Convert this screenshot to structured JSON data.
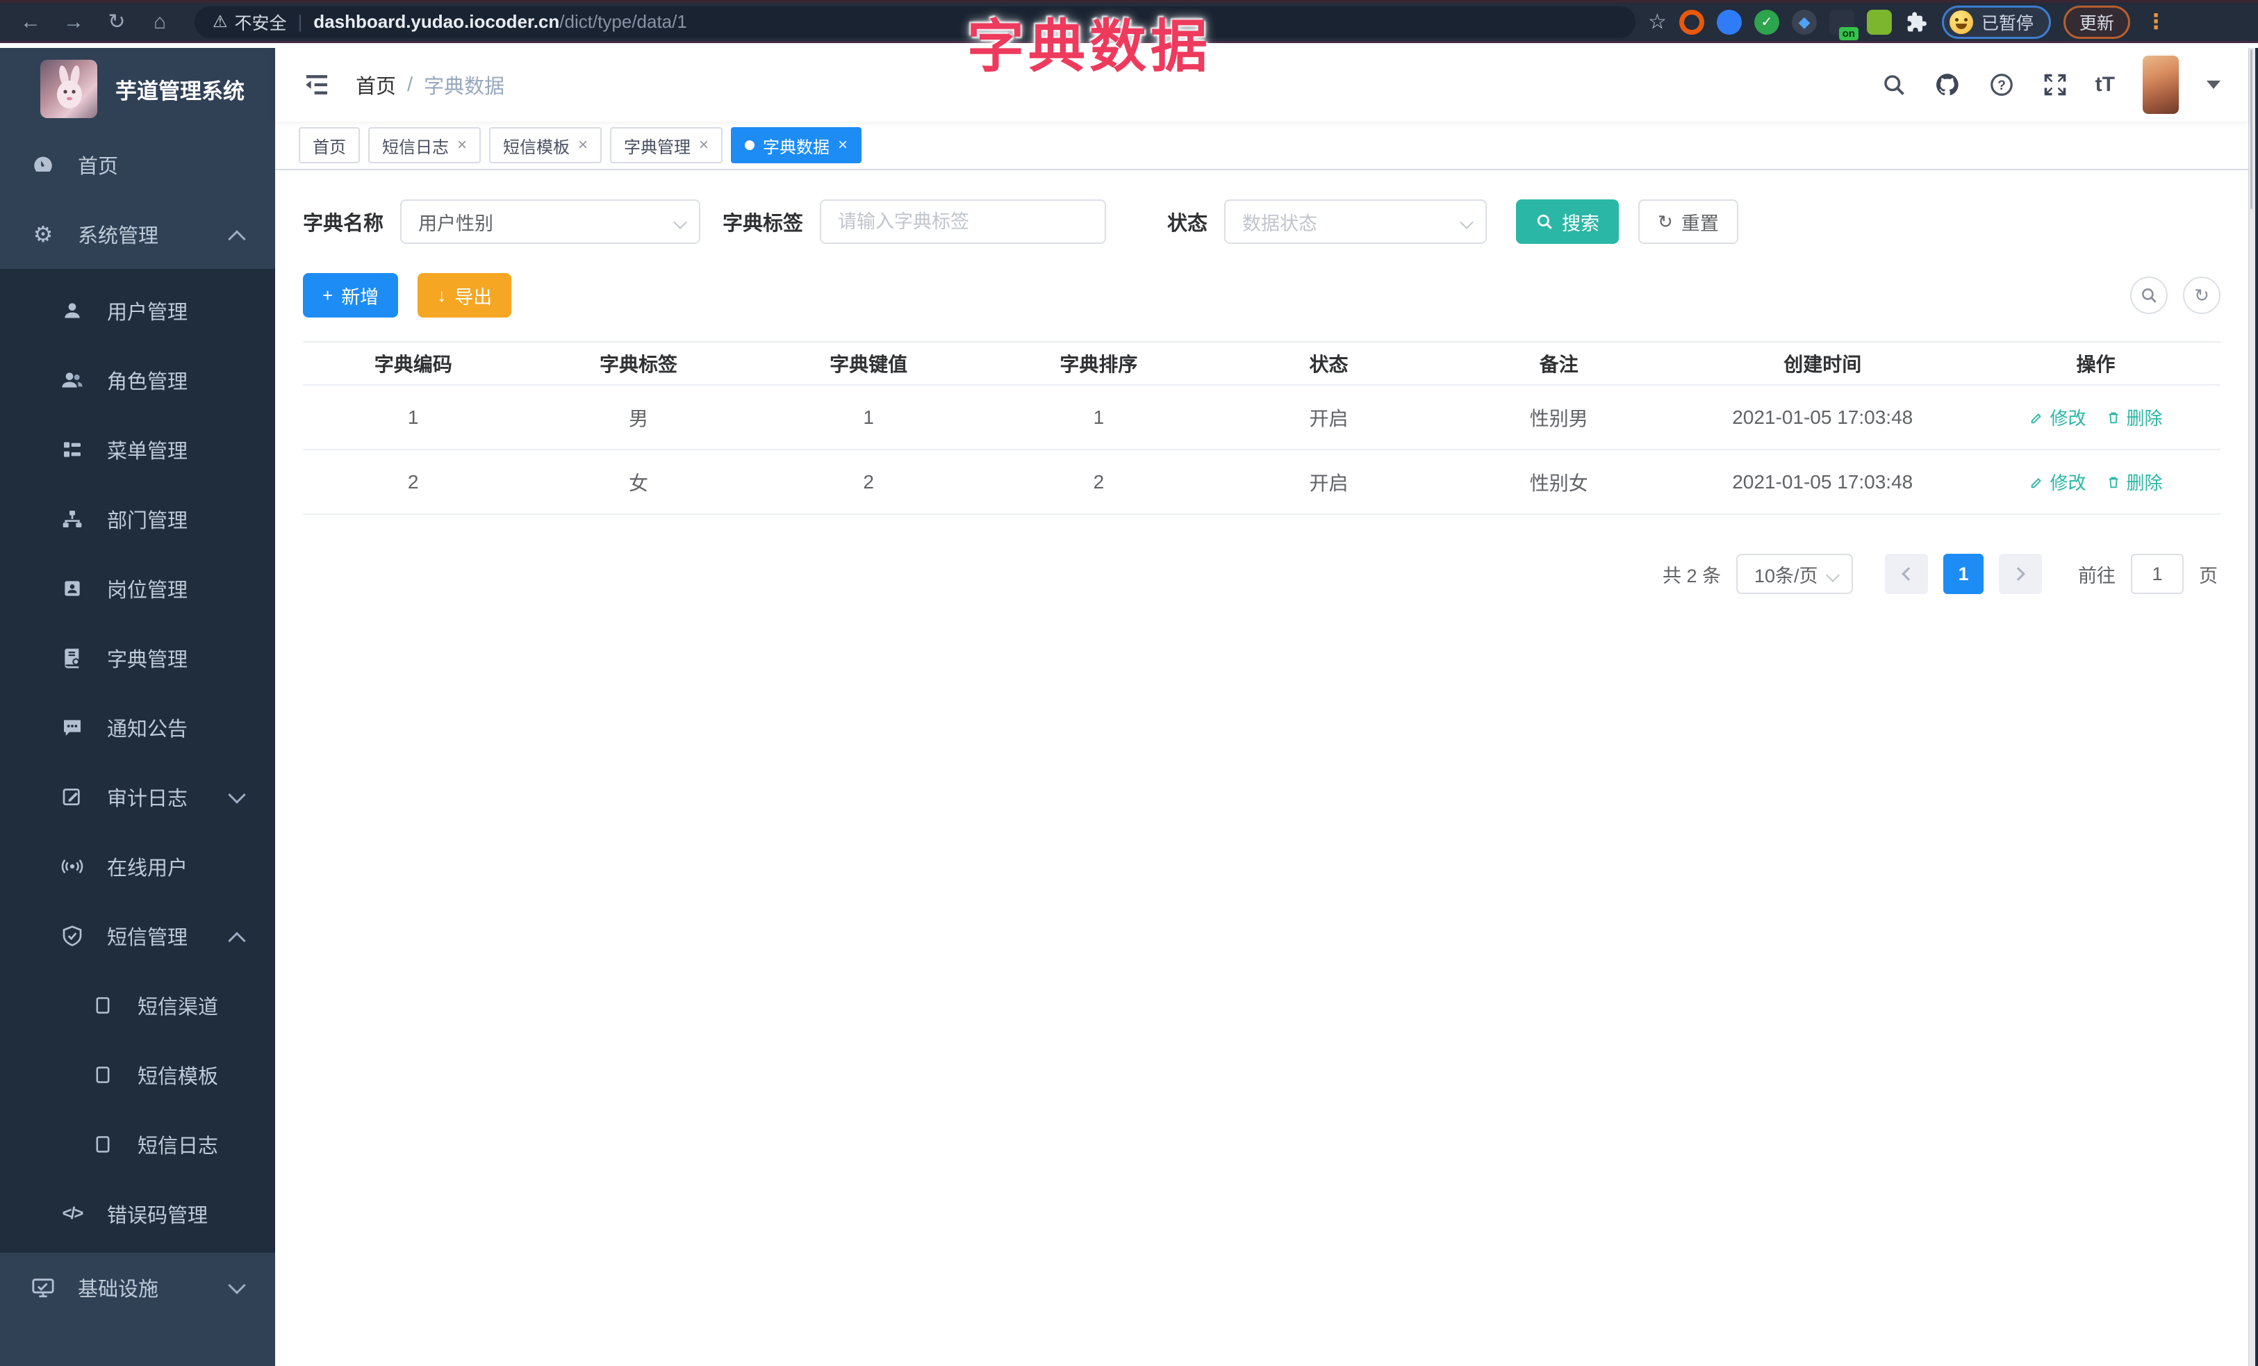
{
  "browser": {
    "security_label": "不安全",
    "url_host": "dashboard.yudao.iocoder.cn",
    "url_path": "/dict/type/data/1",
    "extension_badge": "on",
    "paused_label": "已暂停",
    "update_label": "更新"
  },
  "overlay_title": "字典数据",
  "icons": {
    "back": "←",
    "forward": "→",
    "reload": "↻",
    "home": "⌂",
    "warning": "⚠",
    "star": "☆",
    "dots": "⋮",
    "gear": "⚙",
    "code": "</>",
    "close": "×",
    "plus": "+",
    "download": "↓",
    "refresh": "↻",
    "check": "✓",
    "diamond": "◆",
    "puzzle_shape": "",
    "url_separator": "|",
    "font_size": "tT"
  },
  "sidebar": {
    "logo_title": "芋道管理系统",
    "items": [
      {
        "label": "首页"
      },
      {
        "label": "系统管理"
      },
      {
        "label": "用户管理"
      },
      {
        "label": "角色管理"
      },
      {
        "label": "菜单管理"
      },
      {
        "label": "部门管理"
      },
      {
        "label": "岗位管理"
      },
      {
        "label": "字典管理"
      },
      {
        "label": "通知公告"
      },
      {
        "label": "审计日志"
      },
      {
        "label": "在线用户"
      },
      {
        "label": "短信管理"
      },
      {
        "label": "短信渠道"
      },
      {
        "label": "短信模板"
      },
      {
        "label": "短信日志"
      },
      {
        "label": "错误码管理"
      },
      {
        "label": "基础设施"
      }
    ]
  },
  "header": {
    "breadcrumb_home": "首页",
    "breadcrumb_sep": "/",
    "breadcrumb_current": "字典数据"
  },
  "tabs": [
    {
      "label": "首页"
    },
    {
      "label": "短信日志"
    },
    {
      "label": "短信模板"
    },
    {
      "label": "字典管理"
    },
    {
      "label": "字典数据"
    }
  ],
  "filters": {
    "name_label": "字典名称",
    "name_value": "用户性别",
    "tag_label": "字典标签",
    "tag_placeholder": "请输入字典标签",
    "status_label": "状态",
    "status_placeholder": "数据状态",
    "search_label": "搜索",
    "reset_label": "重置"
  },
  "toolbar": {
    "add_label": "新增",
    "export_label": "导出"
  },
  "table": {
    "columns": [
      "字典编码",
      "字典标签",
      "字典键值",
      "字典排序",
      "状态",
      "备注",
      "创建时间",
      "操作"
    ],
    "rows": [
      {
        "code": "1",
        "label": "男",
        "value": "1",
        "sort": "1",
        "status": "开启",
        "remark": "性别男",
        "created": "2021-01-05 17:03:48"
      },
      {
        "code": "2",
        "label": "女",
        "value": "2",
        "sort": "2",
        "status": "开启",
        "remark": "性别女",
        "created": "2021-01-05 17:03:48"
      }
    ],
    "edit_label": "修改",
    "delete_label": "删除"
  },
  "pagination": {
    "total": "共 2 条",
    "size": "10条/页",
    "page": "1",
    "goto_label": "前往",
    "goto_value": "1",
    "unit_label": "页"
  },
  "colors": {
    "accent_blue": "#1d8cf5",
    "teal": "#2ab7a5",
    "amber": "#f5a623",
    "overlay_red": "#ee3a5d",
    "sidebar_bg": "#304156",
    "submenu_bg": "#1f2d3d",
    "chrome_bg": "#232d3c"
  }
}
